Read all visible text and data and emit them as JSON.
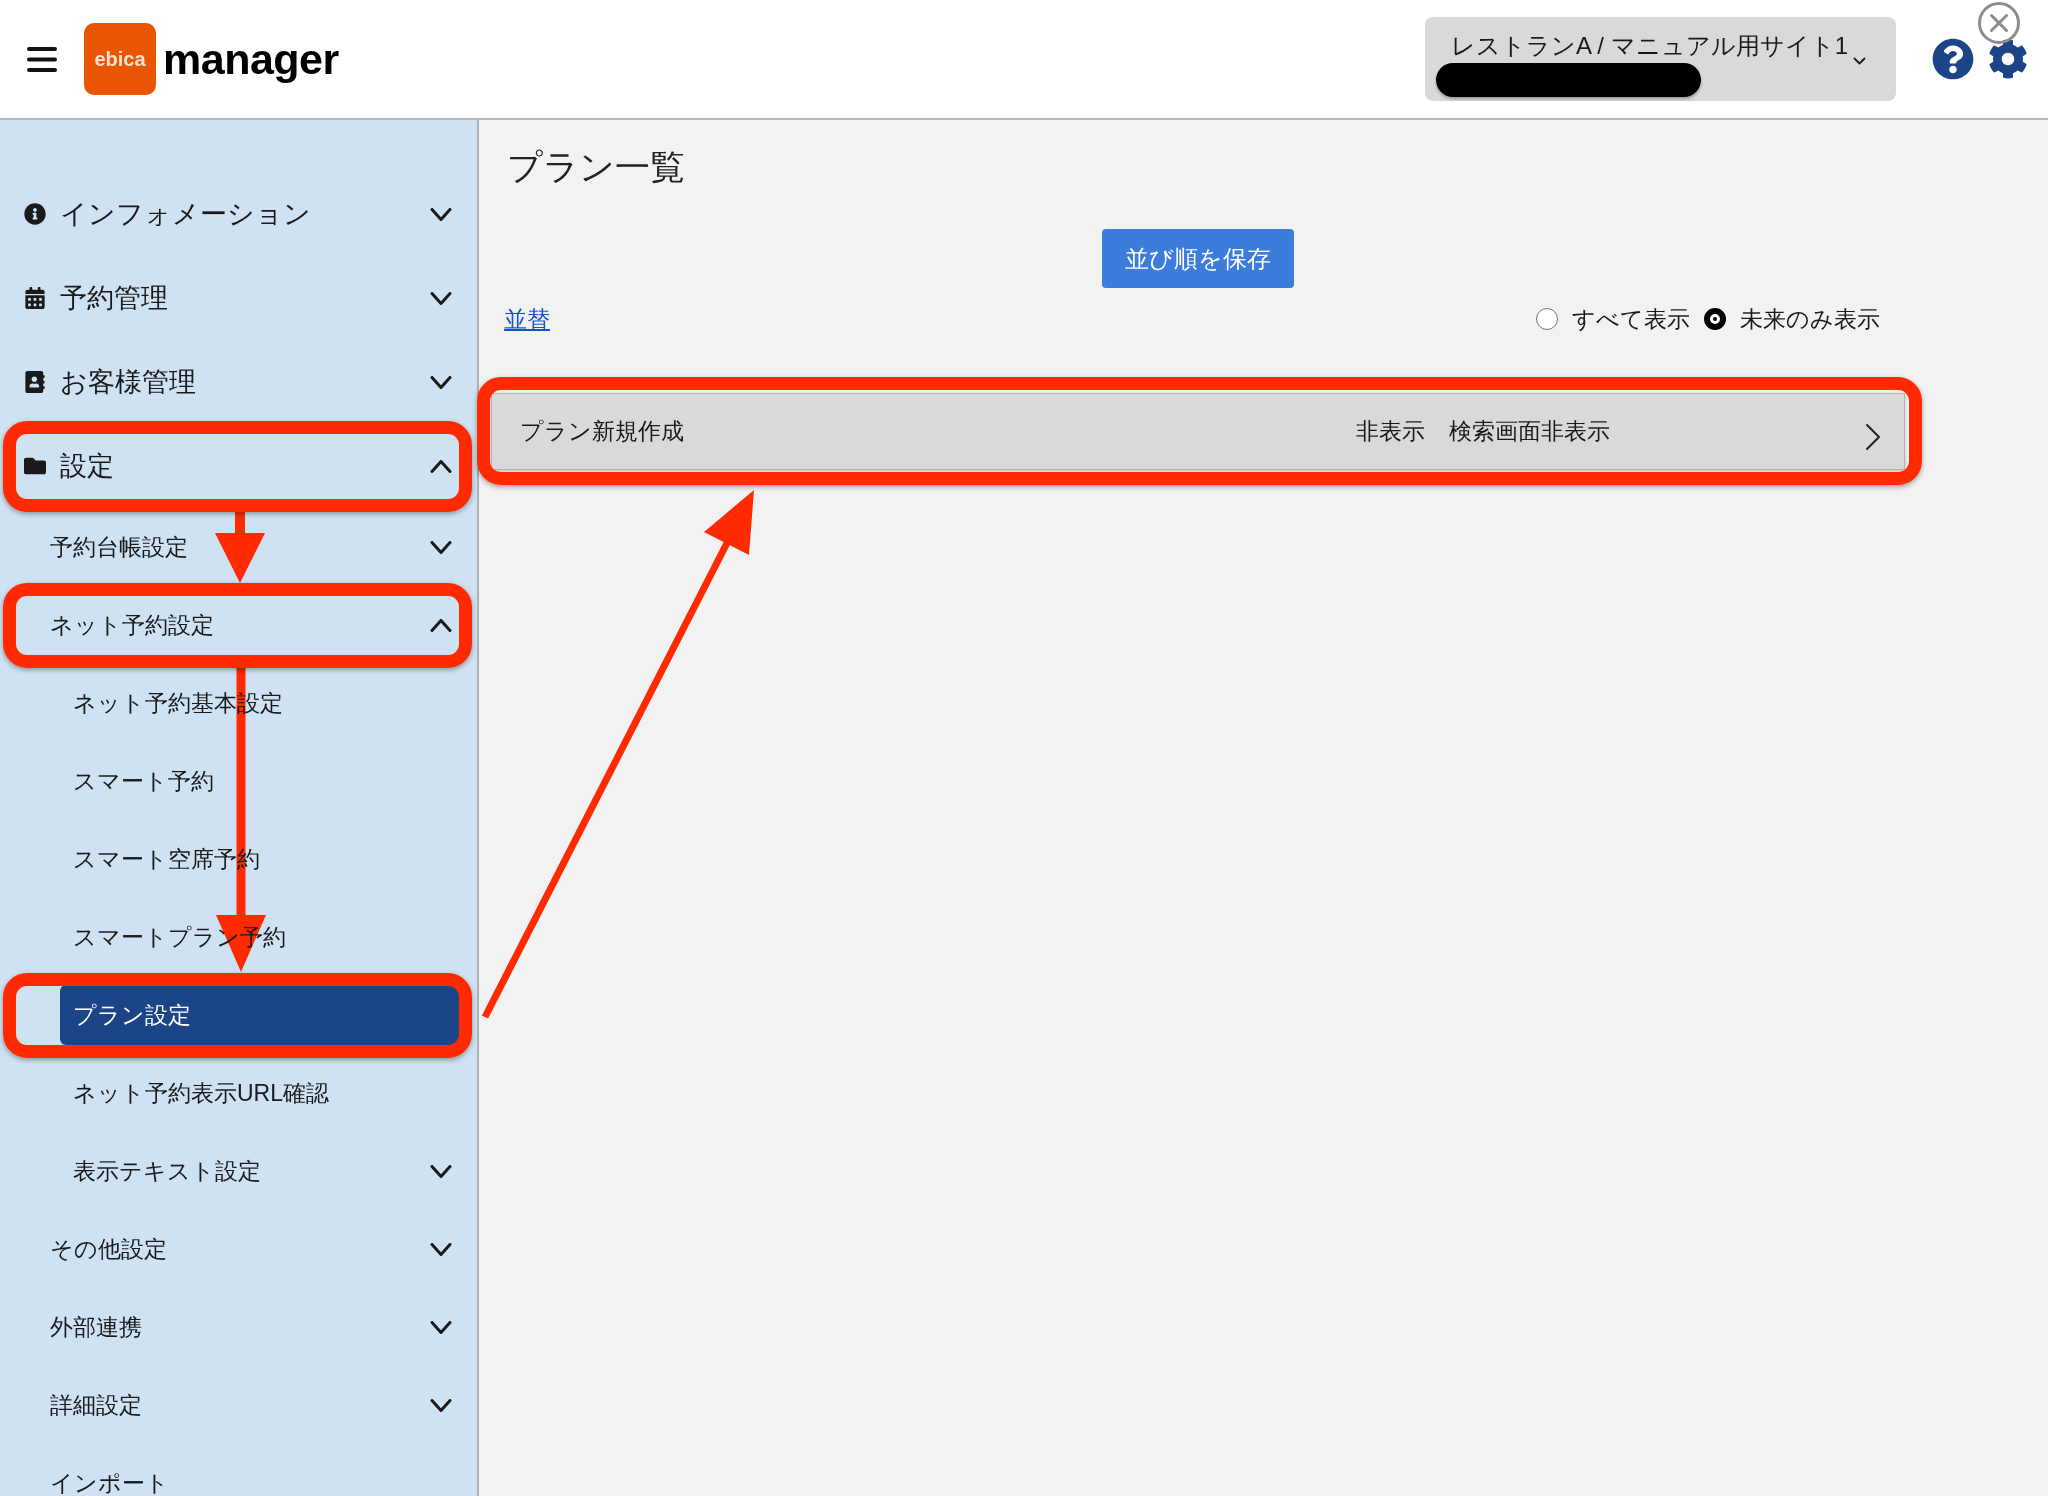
{
  "header": {
    "logo": {
      "mark": "ebica",
      "name": "manager"
    },
    "site_selector": {
      "value": "レストランA / マニュアル用サイト1"
    }
  },
  "sidebar": {
    "items": [
      {
        "label": "インフォメーション",
        "expanded": false,
        "selected": false,
        "outlined": false
      },
      {
        "label": "予約管理",
        "expanded": false,
        "selected": false,
        "outlined": false
      },
      {
        "label": "お客様管理",
        "expanded": false,
        "selected": false,
        "outlined": false
      },
      {
        "label": "設定",
        "expanded": true,
        "selected": false,
        "outlined": true,
        "children": [
          {
            "label": "予約台帳設定",
            "expanded": false,
            "selected": false,
            "outlined": false
          },
          {
            "label": "ネット予約設定",
            "expanded": true,
            "selected": false,
            "outlined": true,
            "children": [
              {
                "label": "ネット予約基本設定",
                "selected": false,
                "outlined": false
              },
              {
                "label": "スマート予約",
                "selected": false,
                "outlined": false
              },
              {
                "label": "スマート空席予約",
                "selected": false,
                "outlined": false
              },
              {
                "label": "スマートプラン予約",
                "selected": false,
                "outlined": false
              },
              {
                "label": "プラン設定",
                "selected": true,
                "outlined": true
              },
              {
                "label": "ネット予約表示URL確認",
                "selected": false,
                "outlined": false
              },
              {
                "label": "表示テキスト設定",
                "expanded": false,
                "selected": false,
                "outlined": false
              }
            ]
          },
          {
            "label": "その他設定",
            "expanded": false,
            "selected": false,
            "outlined": false
          },
          {
            "label": "外部連携",
            "expanded": false,
            "selected": false,
            "outlined": false
          },
          {
            "label": "詳細設定",
            "expanded": false,
            "selected": false,
            "outlined": false
          },
          {
            "label": "インポート",
            "selected": false,
            "outlined": false
          }
        ]
      }
    ]
  },
  "main": {
    "title": "プラン一覧",
    "save_order_button": "並び順を保存",
    "sort_link": "並替",
    "display_filter": [
      {
        "label": "すべて表示",
        "selected": false
      },
      {
        "label": "未来のみ表示",
        "selected": true
      }
    ],
    "plans": [
      {
        "name": "プラン新規作成",
        "statuses": [
          "非表示",
          "検索画面非表示"
        ],
        "outlined": true
      }
    ]
  }
}
